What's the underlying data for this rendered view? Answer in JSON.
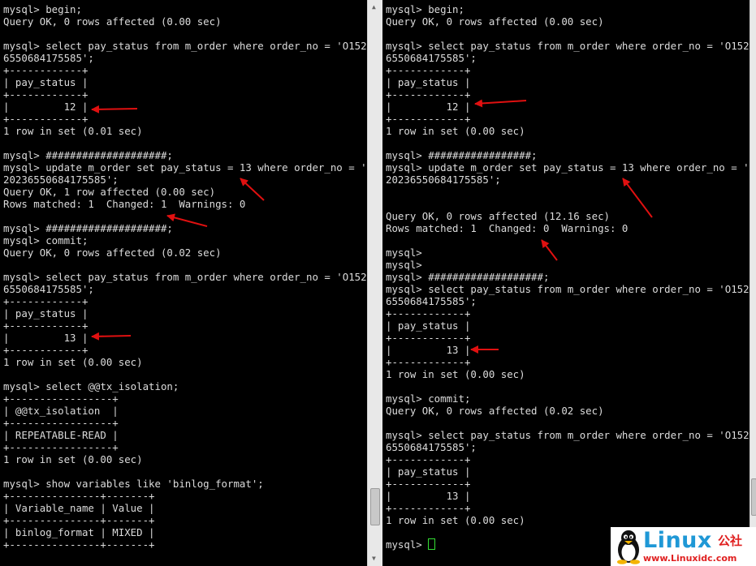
{
  "left_terminal": {
    "lines": [
      "mysql> begin;",
      "Query OK, 0 rows affected (0.00 sec)",
      "",
      "mysql> select pay_status from m_order where order_no = 'O152023",
      "6550684175585';",
      "+------------+",
      "| pay_status |",
      "+------------+",
      "|         12 |",
      "+------------+",
      "1 row in set (0.01 sec)",
      "",
      "mysql> ####################;",
      "mysql> update m_order set pay_status = 13 where order_no = 'O15",
      "20236550684175585';",
      "Query OK, 1 row affected (0.00 sec)",
      "Rows matched: 1  Changed: 1  Warnings: 0",
      "",
      "mysql> ####################;",
      "mysql> commit;",
      "Query OK, 0 rows affected (0.02 sec)",
      "",
      "mysql> select pay_status from m_order where order_no = 'O152023",
      "6550684175585';",
      "+------------+",
      "| pay_status |",
      "+------------+",
      "|         13 |",
      "+------------+",
      "1 row in set (0.00 sec)",
      "",
      "mysql> select @@tx_isolation;",
      "+-----------------+",
      "| @@tx_isolation  |",
      "+-----------------+",
      "| REPEATABLE-READ |",
      "+-----------------+",
      "1 row in set (0.00 sec)",
      "",
      "mysql> show variables like 'binlog_format';",
      "+---------------+-------+",
      "| Variable_name | Value |",
      "+---------------+-------+",
      "| binlog_format | MIXED |",
      "+---------------+-------+"
    ]
  },
  "right_terminal": {
    "lines": [
      "mysql> begin;",
      "Query OK, 0 rows affected (0.00 sec)",
      "",
      "mysql> select pay_status from m_order where order_no = 'O152023",
      "6550684175585';",
      "+------------+",
      "| pay_status |",
      "+------------+",
      "|         12 |",
      "+------------+",
      "1 row in set (0.00 sec)",
      "",
      "mysql> #################;",
      "mysql> update m_order set pay_status = 13 where order_no = 'O15",
      "20236550684175585';",
      "",
      "",
      "Query OK, 0 rows affected (12.16 sec)",
      "Rows matched: 1  Changed: 0  Warnings: 0",
      "",
      "mysql>",
      "mysql>",
      "mysql> ###################;",
      "mysql> select pay_status from m_order where order_no = 'O152023",
      "6550684175585';",
      "+------------+",
      "| pay_status |",
      "+------------+",
      "|         13 |",
      "+------------+",
      "1 row in set (0.00 sec)",
      "",
      "mysql> commit;",
      "Query OK, 0 rows affected (0.02 sec)",
      "",
      "mysql> select pay_status from m_order where order_no = 'O152023",
      "6550684175585';",
      "+------------+",
      "| pay_status |",
      "+------------+",
      "|         13 |",
      "+------------+",
      "1 row in set (0.00 sec)",
      ""
    ],
    "prompt": "mysql> "
  },
  "watermark": {
    "name": "Linux",
    "cn": "公社",
    "url": "www.Linuxidc.com"
  },
  "colors": {
    "terminal_bg": "#000000",
    "terminal_fg": "#dcdcdc",
    "cursor": "#34e034",
    "annotation_arrow": "#e01010",
    "watermark_blue": "#1f98d6",
    "watermark_red": "#e02020"
  },
  "icons": [
    "penguin-logo",
    "red-annotation-arrow",
    "scrollbar-up-arrow",
    "scrollbar-down-arrow"
  ]
}
